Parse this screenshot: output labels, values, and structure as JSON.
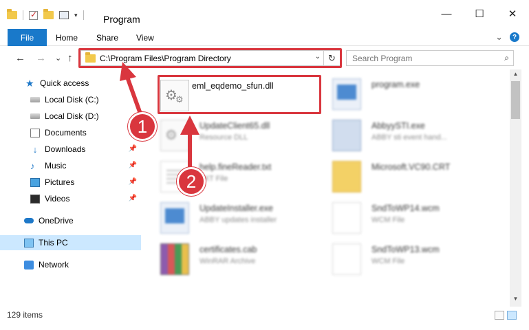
{
  "window": {
    "title": "Program",
    "controls": {
      "minimize": "—",
      "maximize": "☐",
      "close": "✕"
    }
  },
  "ribbon": {
    "tabs": {
      "file": "File",
      "home": "Home",
      "share": "Share",
      "view": "View"
    },
    "chevron": "⌄",
    "help": "?"
  },
  "navigation": {
    "back": "←",
    "forward": "→",
    "recent": "⌄",
    "up": "↑",
    "address": "C:\\Program Files\\Program Directory",
    "address_dropdown": "⌄",
    "refresh": "↻",
    "search_placeholder": "Search Program",
    "search_icon": "⌕"
  },
  "sidebar": {
    "items": [
      {
        "label": "Quick access",
        "icon": "star-icon",
        "pinned": false
      },
      {
        "label": "Local Disk (C:)",
        "icon": "disk-icon",
        "pinned": false
      },
      {
        "label": "Local Disk (D:)",
        "icon": "disk-icon",
        "pinned": false
      },
      {
        "label": "Documents",
        "icon": "documents-icon",
        "pinned": true
      },
      {
        "label": "Downloads",
        "icon": "downloads-icon",
        "pinned": true
      },
      {
        "label": "Music",
        "icon": "music-icon",
        "pinned": true
      },
      {
        "label": "Pictures",
        "icon": "pictures-icon",
        "pinned": true
      },
      {
        "label": "Videos",
        "icon": "videos-icon",
        "pinned": true
      },
      {
        "label": "OneDrive",
        "icon": "onedrive-icon",
        "pinned": false
      },
      {
        "label": "This PC",
        "icon": "this-pc-icon",
        "pinned": false,
        "selected": true
      },
      {
        "label": "Network",
        "icon": "network-icon",
        "pinned": false
      }
    ],
    "pin_glyph": "📌"
  },
  "files": [
    {
      "name": "eml_eqdemo_sfun.dll",
      "sub": "",
      "icon": "dll-icon",
      "highlighted": true
    },
    {
      "name": "program.exe",
      "sub": "",
      "icon": "exe-icon"
    },
    {
      "name": "UpdateClient65.dll",
      "sub": "Resource DLL",
      "icon": "dll-icon"
    },
    {
      "name": "AbbyySTI.exe",
      "sub": "ABBY sti event hand...",
      "icon": "app-icon"
    },
    {
      "name": "help.fineReader.txt",
      "sub": "TXT File",
      "icon": "text-file-icon"
    },
    {
      "name": "Microsoft.VC90.CRT",
      "sub": "",
      "icon": "folder-icon"
    },
    {
      "name": "UpdateInstaller.exe",
      "sub": "ABBY updates installer",
      "icon": "exe-icon"
    },
    {
      "name": "SndToWP14.wcm",
      "sub": "WCM File",
      "icon": "blank-file-icon"
    },
    {
      "name": "certificates.cab",
      "sub": "WinRAR Archive",
      "icon": "archive-icon"
    },
    {
      "name": "SndToWP13.wcm",
      "sub": "WCM File",
      "icon": "blank-file-icon"
    }
  ],
  "status": {
    "item_count": "129 items"
  },
  "callouts": {
    "step1": "1",
    "step2": "2"
  },
  "colors": {
    "accent": "#1979ca",
    "highlight": "#d9363e",
    "selected": "#cce8ff"
  }
}
